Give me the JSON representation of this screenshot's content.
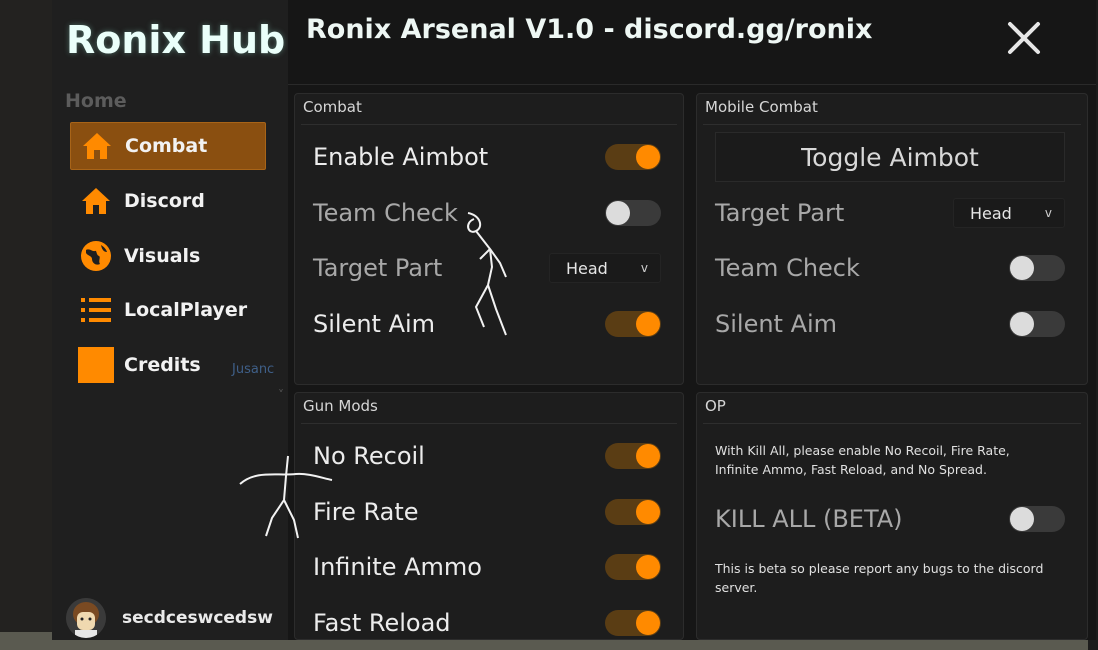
{
  "app": {
    "brand": "Ronix Hub",
    "title": "Ronix Arsenal V1.0 - discord.gg/ronix",
    "close_glyph": "✕",
    "accent": "#ff8a00"
  },
  "sidebar": {
    "section": "Home",
    "items": [
      {
        "label": "Combat",
        "icon": "home-icon",
        "active": true
      },
      {
        "label": "Discord",
        "icon": "home-icon",
        "active": false
      },
      {
        "label": "Visuals",
        "icon": "globe-icon",
        "active": false
      },
      {
        "label": "LocalPlayer",
        "icon": "list-icon",
        "active": false
      },
      {
        "label": "Credits",
        "icon": "square-icon",
        "active": false
      }
    ],
    "ghost_text": "Jusanc",
    "ghost_mark": "˅",
    "username": "secdceswcedsw"
  },
  "panels": {
    "combat": {
      "header": "Combat",
      "enable_aimbot": "Enable Aimbot",
      "team_check": "Team Check",
      "target_part": "Target Part",
      "target_part_value": "Head",
      "silent_aim": "Silent Aim"
    },
    "mobile": {
      "header": "Mobile Combat",
      "toggle_button": "Toggle Aimbot",
      "target_part": "Target Part",
      "target_part_value": "Head",
      "team_check": "Team Check",
      "silent_aim": "Silent Aim"
    },
    "gunmods": {
      "header": "Gun Mods",
      "no_recoil": "No Recoil",
      "fire_rate": "Fire Rate",
      "infinite_ammo": "Infinite Ammo",
      "fast_reload": "Fast Reload"
    },
    "op": {
      "header": "OP",
      "note_top": "With Kill All, please enable No Recoil, Fire Rate, Infinite Ammo, Fast Reload, and No Spread.",
      "kill_all": "KILL ALL (BETA)",
      "note_bottom": "This is beta so please report any bugs to the discord server."
    }
  },
  "dropdown_chevron": "v"
}
